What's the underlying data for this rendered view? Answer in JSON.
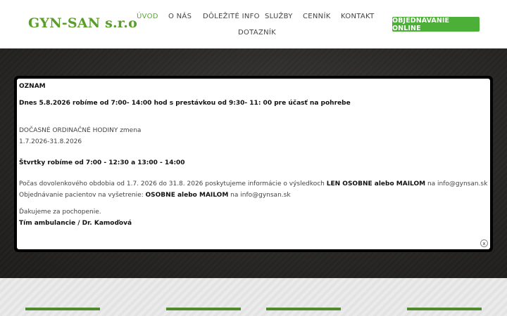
{
  "header": {
    "logo": "GYN-SAN s.r.o",
    "nav": [
      "ÚVOD",
      "O NÁS",
      "DÔLEŽITÉ INFO",
      "SLUŽBY",
      "CENNÍK",
      "KONTAKT",
      "DOTAZNÍK"
    ],
    "cta_label": "OBJEDNÁVANIE ONLINE"
  },
  "modal": {
    "title": "OZNAM",
    "line_closure": "Dnes 5.8.2026 robíme od 7:00- 14:00 hod s prestávkou od 9:30- 11: 00 pre účasť na pohrebe",
    "temp_hours_heading": "DOČASNÉ ORDINAČNÉ HODINY zmena",
    "temp_hours_range": "1.7.2026-31.8.2026",
    "thursday_hours": "Štvrtky robíme od 7:00 - 12:30 a 13:00 - 14:00",
    "vacation_prefix": "Počas dovolenkového obdobia od 1.7. 2026 do 31.8. 2026 poskytujeme informácie o výsledkoch ",
    "vacation_bold": "LEN OSOBNE alebo MAILOM",
    "vacation_suffix": " na info@gynsan.sk",
    "ordering_prefix": "Objednávanie pacientov na vyšetrenie: ",
    "ordering_bold": "OSOBNE alebo MAILOM",
    "ordering_suffix": " na info@gynsan.sk",
    "thanks": "Ďakujeme za pochopenie.",
    "signature": "Tím ambulancie / Dr. Kamoďová",
    "close_label": "x"
  },
  "colors": {
    "brand_green": "#5a9e2a",
    "cta_green": "#4caf38",
    "active_nav": "#58a82a"
  }
}
